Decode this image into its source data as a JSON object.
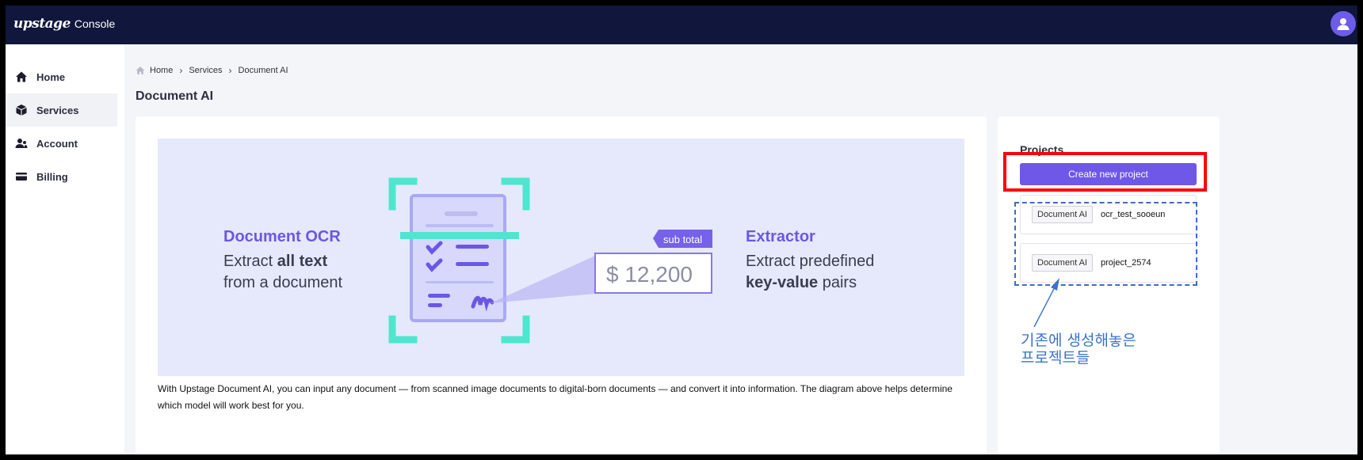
{
  "app": {
    "logo": "upstage",
    "logo_sub": "Console"
  },
  "header": {
    "avatar_icon": "user-icon"
  },
  "sidebar": {
    "items": [
      {
        "label": "Home",
        "icon": "home-icon",
        "active": false
      },
      {
        "label": "Services",
        "icon": "cube-icon",
        "active": true
      },
      {
        "label": "Account",
        "icon": "account-icon",
        "active": false
      },
      {
        "label": "Billing",
        "icon": "credit-card-icon",
        "active": false
      }
    ]
  },
  "breadcrumb": {
    "items": [
      "Home",
      "Services",
      "Document AI"
    ],
    "home_icon": "home-icon",
    "separator_icon": "chevron-right-icon"
  },
  "page": {
    "title": "Document AI"
  },
  "hero": {
    "ocr_title": "Document OCR",
    "ocr_line1_pre": "Extract ",
    "ocr_line1_bold": "all text",
    "ocr_line2": "from a document",
    "tag": "sub total",
    "amount": "$ 12,200",
    "extractor_title": "Extractor",
    "extractor_line1": "Extract predefined",
    "extractor_line2_bold": "key-value",
    "extractor_line2_post": " pairs"
  },
  "description": "With Upstage Document AI, you can input any document — from scanned image documents to digital-born documents — and convert it into information. The diagram above helps determine which model will work best for you.",
  "projects": {
    "title": "Projects",
    "create_label": "Create new project",
    "items": [
      {
        "tag": "Document AI",
        "name": "ocr_test_sooeun"
      },
      {
        "tag": "Document AI",
        "name": "project_2574"
      }
    ]
  },
  "annotation": {
    "line1": "기존에 생성해놓은",
    "line2": "프로젝트들"
  },
  "colors": {
    "topbar": "#10163c",
    "accent": "#6f57e8",
    "teal": "#4ee6cf",
    "hero_bg": "#e6e9fb",
    "highlight": "#ff0000",
    "note": "#3b73c9"
  }
}
